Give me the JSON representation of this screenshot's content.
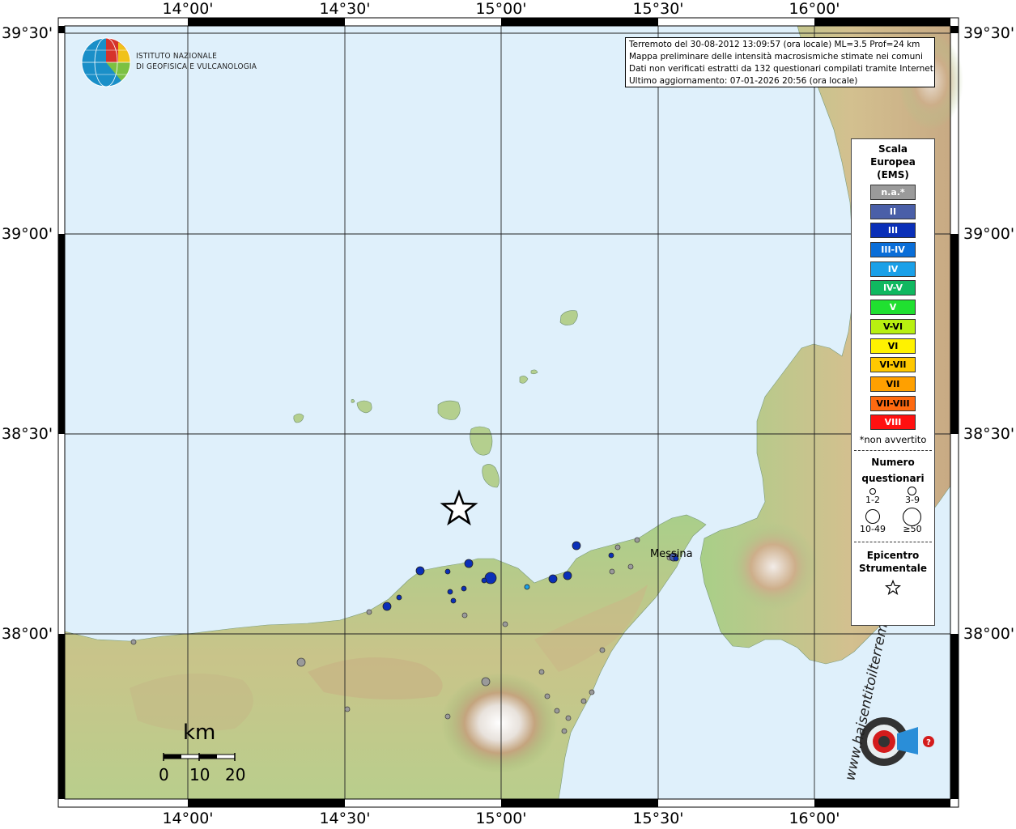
{
  "info": {
    "line1": "Terremoto del 30-08-2012 13:09:57 (ora locale) ML=3.5 Prof=24 km",
    "line2": "Mappa preliminare delle intensità macrosismiche stimate nei comuni",
    "line3": "Dati non verificati estratti da 132 questionari compilati tramite Internet.",
    "line4": "Ultimo aggiornamento: 07-01-2026 20:56 (ora locale)"
  },
  "logo": {
    "line1": "ISTITUTO NAZIONALE",
    "line2": "DI GEOFISICA E VULCANOLOGIA"
  },
  "axes": {
    "lon_top": [
      "14°00'",
      "14°30'",
      "15°00'",
      "15°30'",
      "16°00'"
    ],
    "lon_bottom": [
      "14°00'",
      "14°30'",
      "15°00'",
      "15°30'",
      "16°00'"
    ],
    "lat_left": [
      "39°30'",
      "39°00'",
      "38°30'",
      "38°00'"
    ],
    "lat_right": [
      "39°30'",
      "39°00'",
      "38°30'",
      "38°00'"
    ]
  },
  "legend": {
    "title1": "Scala",
    "title2": "Europea",
    "title3": "(EMS)",
    "items": [
      {
        "label": "n.a.*",
        "color": "#9a9a9a"
      },
      {
        "label": "II",
        "color": "#4a5fa8"
      },
      {
        "label": "III",
        "color": "#0a2fb8"
      },
      {
        "label": "III-IV",
        "color": "#0a6ed8"
      },
      {
        "label": "IV",
        "color": "#1aa0e8"
      },
      {
        "label": "IV-V",
        "color": "#10b860"
      },
      {
        "label": "V",
        "color": "#20e030"
      },
      {
        "label": "V-VI",
        "color": "#b8f010"
      },
      {
        "label": "VI",
        "color": "#fff200"
      },
      {
        "label": "VI-VII",
        "color": "#ffc800"
      },
      {
        "label": "VII",
        "color": "#ffa000"
      },
      {
        "label": "VII-VIII",
        "color": "#ff6a10"
      },
      {
        "label": "VIII",
        "color": "#ff1010"
      }
    ],
    "note": "*non avvertito",
    "count_title1": "Numero",
    "count_title2": "questionari",
    "count_labels": [
      "1-2",
      "3-9",
      "10-49",
      "≥50"
    ],
    "epi_title1": "Epicentro",
    "epi_title2": "Strumentale"
  },
  "city": "Messina",
  "scalebar": {
    "unit": "km",
    "labels": [
      "0",
      "10",
      "20"
    ]
  },
  "watermark": "www.haisentitoilterremoto.it"
}
